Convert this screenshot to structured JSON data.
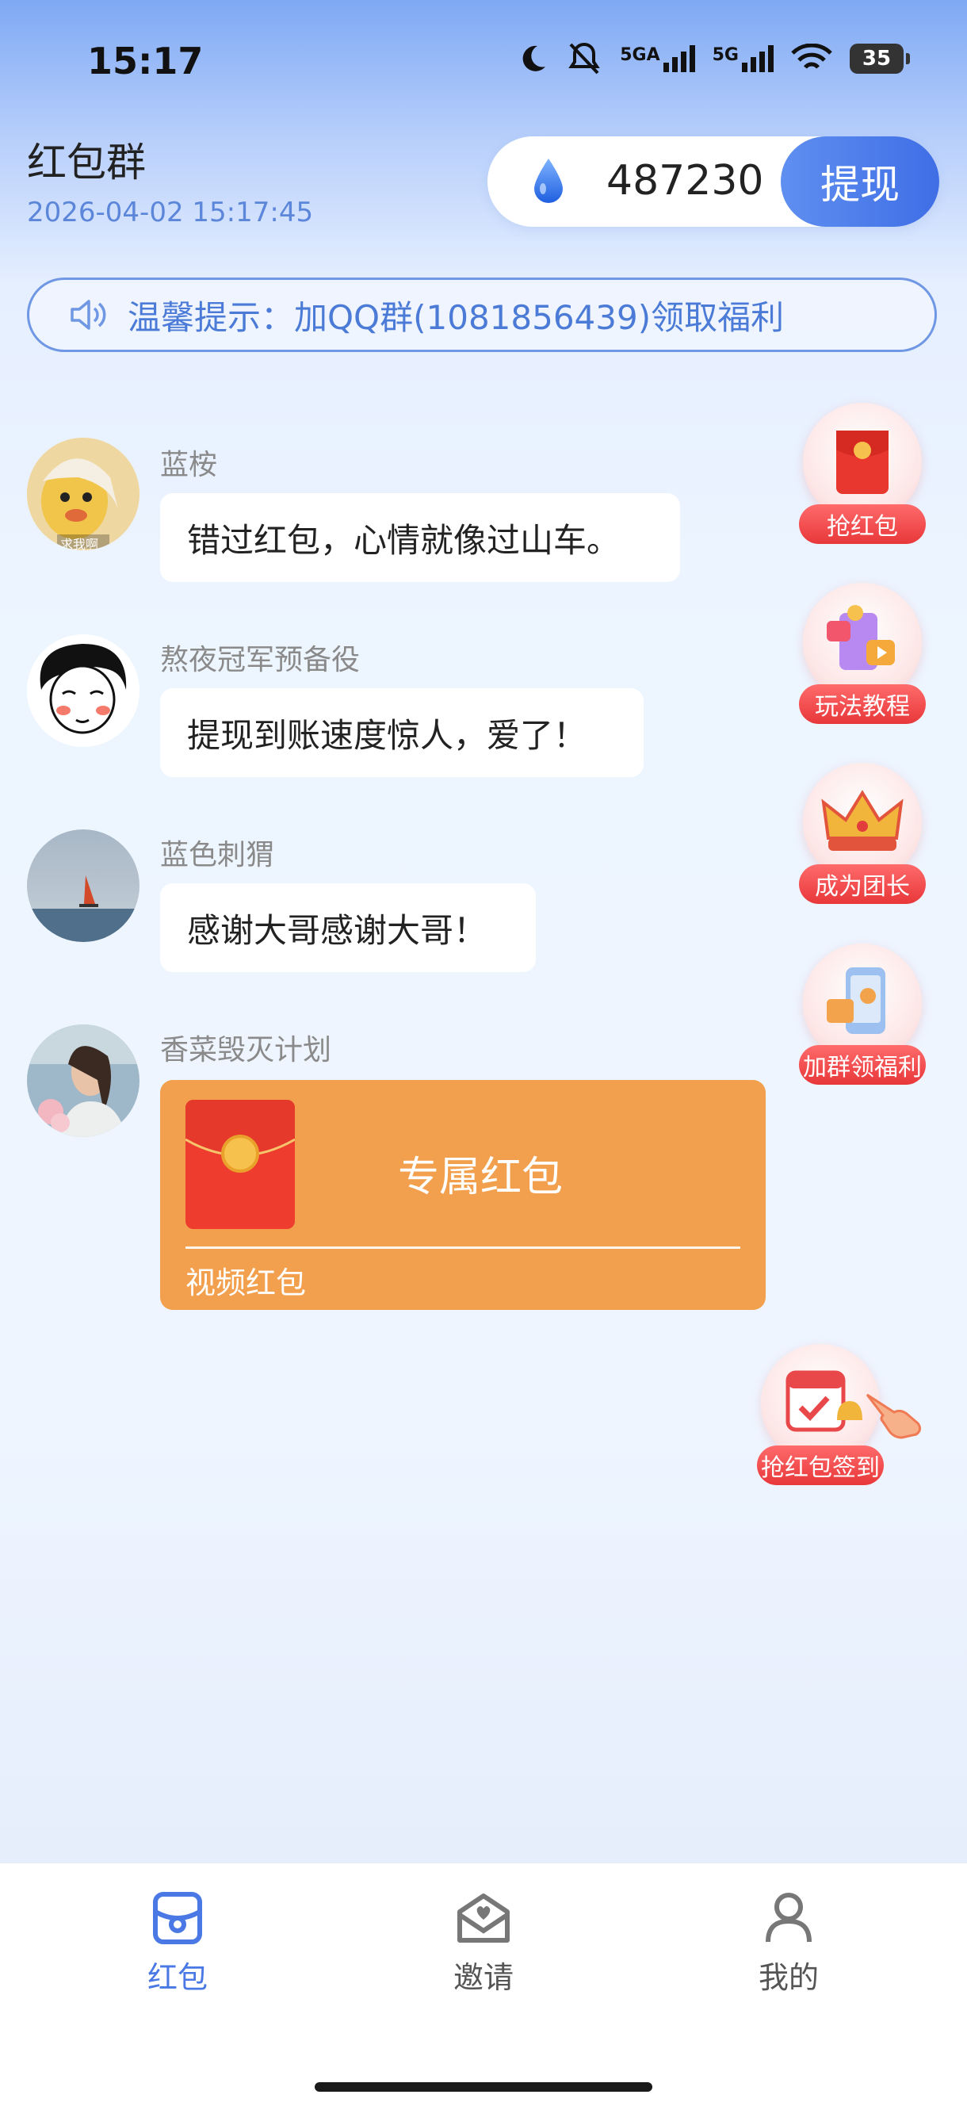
{
  "status_bar": {
    "time": "15:17",
    "network_1": "5GA",
    "network_2": "5G",
    "battery": "35"
  },
  "header": {
    "title": "红包群",
    "datetime": "2026-04-02 15:17:45",
    "balance": "487230",
    "withdraw_label": "提现"
  },
  "notice": {
    "text": "温馨提示：加QQ群(1081856439)领取福利"
  },
  "messages": [
    {
      "sender": "蓝桉",
      "text": "错过红包，心情就像过山车。",
      "avatar_caption": "求我啊"
    },
    {
      "sender": "熬夜冠军预备役",
      "text": "提现到账速度惊人，爱了！"
    },
    {
      "sender": "蓝色刺猬",
      "text": "感谢大哥感谢大哥！"
    },
    {
      "sender": "香菜毁灭计划",
      "redpacket": {
        "title": "专属红包",
        "subtitle": "视频红包"
      }
    }
  ],
  "side_buttons": [
    {
      "label": "抢红包",
      "icon": "red-envelope-icon"
    },
    {
      "label": "玩法教程",
      "icon": "tutorial-icon"
    },
    {
      "label": "成为团长",
      "icon": "crown-icon"
    },
    {
      "label": "加群领福利",
      "icon": "group-gift-icon"
    },
    {
      "label": "抢红包签到",
      "icon": "calendar-checkin-icon"
    }
  ],
  "nav": [
    {
      "label": "红包",
      "icon": "redpacket-nav-icon",
      "active": true
    },
    {
      "label": "邀请",
      "icon": "invite-nav-icon",
      "active": false
    },
    {
      "label": "我的",
      "icon": "profile-nav-icon",
      "active": false
    }
  ],
  "colors": {
    "accent": "#4a78e4",
    "redpacket_bg": "#f2a04e",
    "side_label": "#e8373a"
  }
}
